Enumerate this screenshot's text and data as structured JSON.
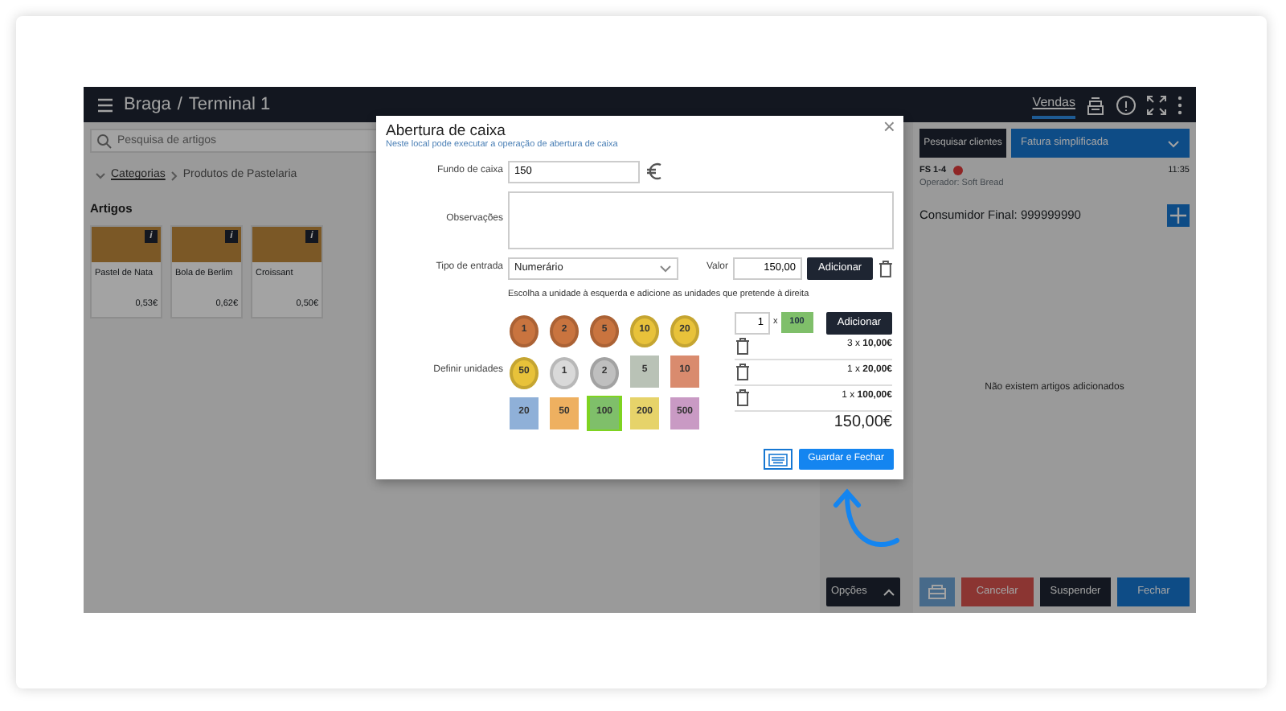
{
  "header": {
    "location": "Braga",
    "separator": "/",
    "terminal": "Terminal 1",
    "nav": [
      {
        "label": "Vendas",
        "selected": true
      }
    ]
  },
  "catalog": {
    "search": {
      "placeholder": "Pesquisa de artigos"
    },
    "breadcrumb": [
      {
        "label": "Categorias",
        "link": true
      },
      {
        "label": "Produtos de Pastelaria",
        "link": false
      }
    ],
    "section_title": "Artigos",
    "products": [
      {
        "name": "Pastel de Nata",
        "price": "0,53€",
        "info": "i"
      },
      {
        "name": "Bola de Berlim",
        "price": "0,62€",
        "info": "i"
      },
      {
        "name": "Croissant",
        "price": "0,50€",
        "info": "i"
      }
    ]
  },
  "options_button": "Opções",
  "order": {
    "search_clients": "Pesquisar clientes",
    "doc_type": "Fatura simplificada",
    "doc_number": "FS 1-4",
    "time": "11:35",
    "operator": "Operador: Soft Bread",
    "customer": "Consumidor Final: 999999990",
    "empty_message": "Não existem artigos adicionados",
    "actions": [
      {
        "kind": "drawer"
      },
      {
        "kind": "danger",
        "label": "Cancelar"
      },
      {
        "kind": "dark",
        "label": "Suspender"
      },
      {
        "kind": "primary",
        "label": "Fechar"
      }
    ]
  },
  "modal": {
    "title": "Abertura de caixa",
    "subtitle": "Neste local pode executar a operação de abertura de caixa",
    "close": "×",
    "fund_label": "Fundo de caixa",
    "fund_value": "150",
    "notes_label": "Observações",
    "entry_label": "Tipo de entrada",
    "entry_type": "Numerário",
    "value_label": "Valor",
    "value": "150,00",
    "add_button": "Adicionar",
    "hint": "Escolha a unidade à esquerda e adicione as unidades que pretende à direita",
    "units_label": "Definir unidades",
    "units": [
      {
        "kind": "coin",
        "label": "1",
        "color": "#c9743f",
        "selected": false
      },
      {
        "kind": "coin",
        "label": "2",
        "color": "#c9743f",
        "selected": false
      },
      {
        "kind": "coin",
        "label": "5",
        "color": "#c9743f",
        "selected": false
      },
      {
        "kind": "coin",
        "label": "10",
        "color": "#e8c23a",
        "selected": false
      },
      {
        "kind": "coin",
        "label": "20",
        "color": "#e8c23a",
        "selected": false
      },
      {
        "kind": "coin",
        "label": "50",
        "color": "#e8c23a",
        "selected": false
      },
      {
        "kind": "coin",
        "label": "1",
        "color": "#d9d9d9",
        "selected": false
      },
      {
        "kind": "coin",
        "label": "2",
        "color": "#bfbfbf",
        "selected": false
      },
      {
        "kind": "note",
        "label": "5",
        "color": "#b9c2b6",
        "selected": false
      },
      {
        "kind": "note",
        "label": "10",
        "color": "#d98b6e",
        "selected": false
      },
      {
        "kind": "note",
        "label": "20",
        "color": "#8fb0d8",
        "selected": false
      },
      {
        "kind": "note",
        "label": "50",
        "color": "#eeb060",
        "selected": false
      },
      {
        "kind": "note",
        "label": "100",
        "color": "#7fbf6a",
        "selected": true
      },
      {
        "kind": "note",
        "label": "200",
        "color": "#e6d36a",
        "selected": false
      },
      {
        "kind": "note",
        "label": "500",
        "color": "#c99ac4",
        "selected": false
      }
    ],
    "quantity": "1",
    "times": "x",
    "preview": {
      "label": "100",
      "color": "#7fbf6a"
    },
    "add_unit_button": "Adicionar",
    "lines": [
      "3 x **10,00€**",
      "1 x **20,00€**",
      "1 x **100,00€**"
    ],
    "total": "150,00€",
    "save_button": "Guardar e Fechar"
  }
}
